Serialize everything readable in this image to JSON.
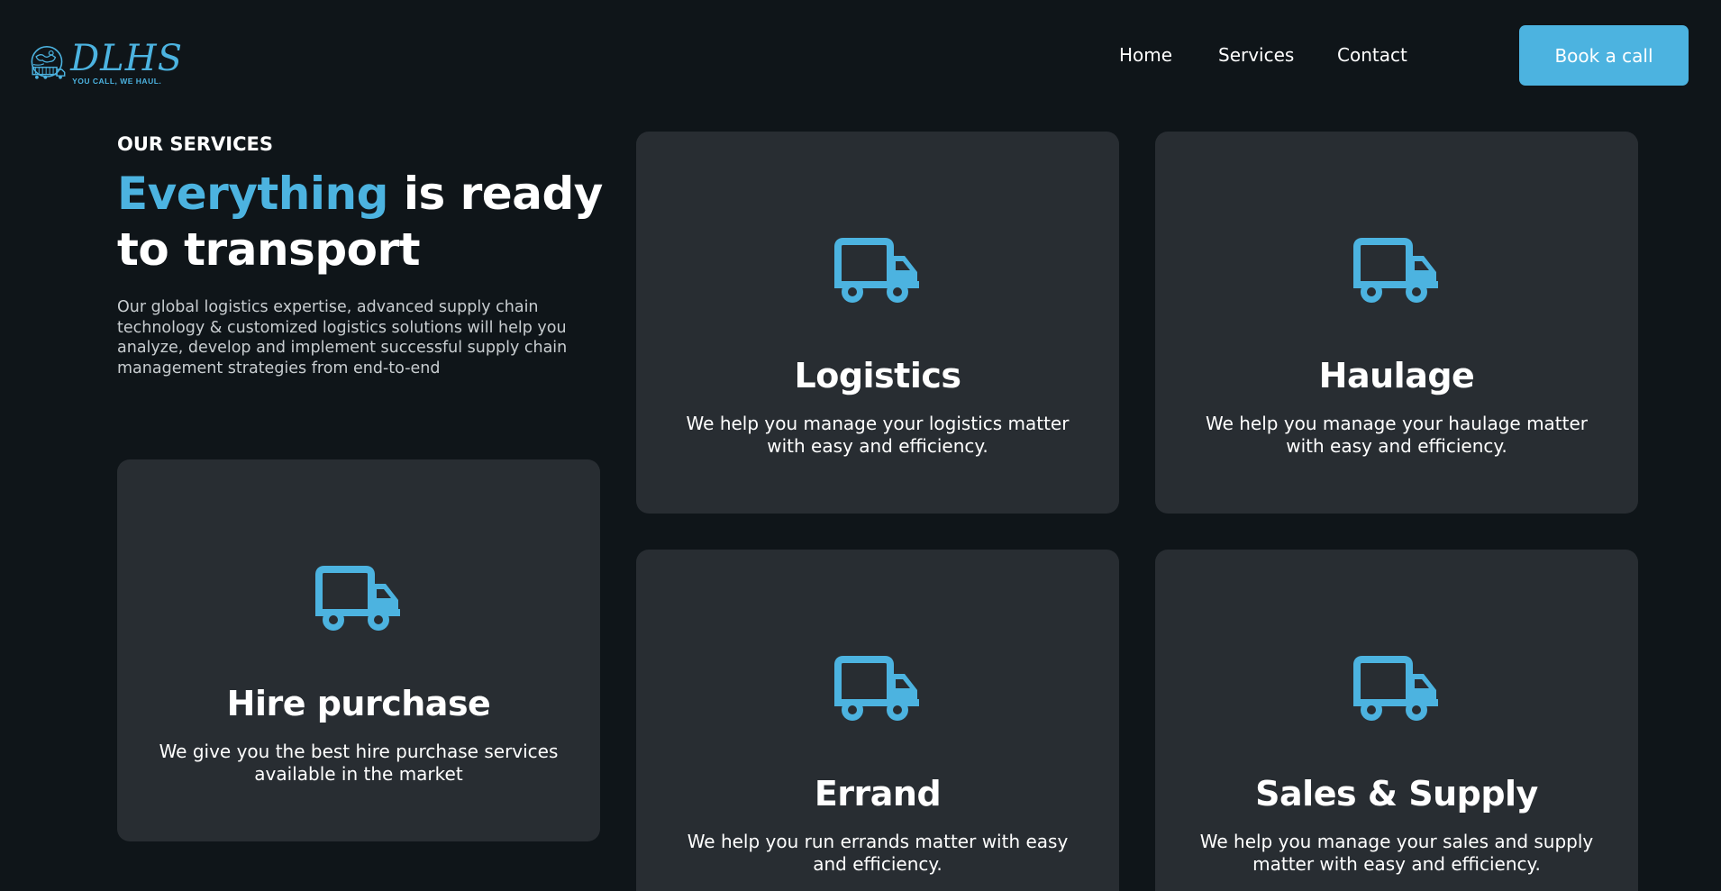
{
  "brand": {
    "name": "DLHS",
    "tagline": "YOU CALL, WE HAUL.",
    "accent_color": "#4cb3e0",
    "background": "#0f1519",
    "card_color": "#282d32"
  },
  "nav": {
    "items": [
      {
        "label": "Home"
      },
      {
        "label": "Services"
      },
      {
        "label": "Contact"
      }
    ],
    "cta_label": "Book a call"
  },
  "intro": {
    "eyebrow": "OUR SERVICES",
    "headline_accent": "Everything",
    "headline_rest_1": " is ready",
    "headline_rest_2": "to transport",
    "description": "Our global logistics expertise, advanced supply chain technology & customized logistics solutions will help you analyze, develop and implement successful supply chain management strategies from end-to-end"
  },
  "services": [
    {
      "icon": "truck-icon",
      "title": "Logistics",
      "description": "We help you manage your logistics matter with easy and efficiency."
    },
    {
      "icon": "truck-icon",
      "title": "Haulage",
      "description": "We help you manage your haulage matter with easy and efficiency."
    },
    {
      "icon": "truck-icon",
      "title": "Hire purchase",
      "description": "We give you the best hire purchase services available in the market"
    },
    {
      "icon": "truck-icon",
      "title": "Errand",
      "description": "We help you run errands matter with easy and efficiency."
    },
    {
      "icon": "truck-icon",
      "title": "Sales & Supply",
      "description": "We help you manage your sales and supply matter with easy and efficiency."
    }
  ]
}
